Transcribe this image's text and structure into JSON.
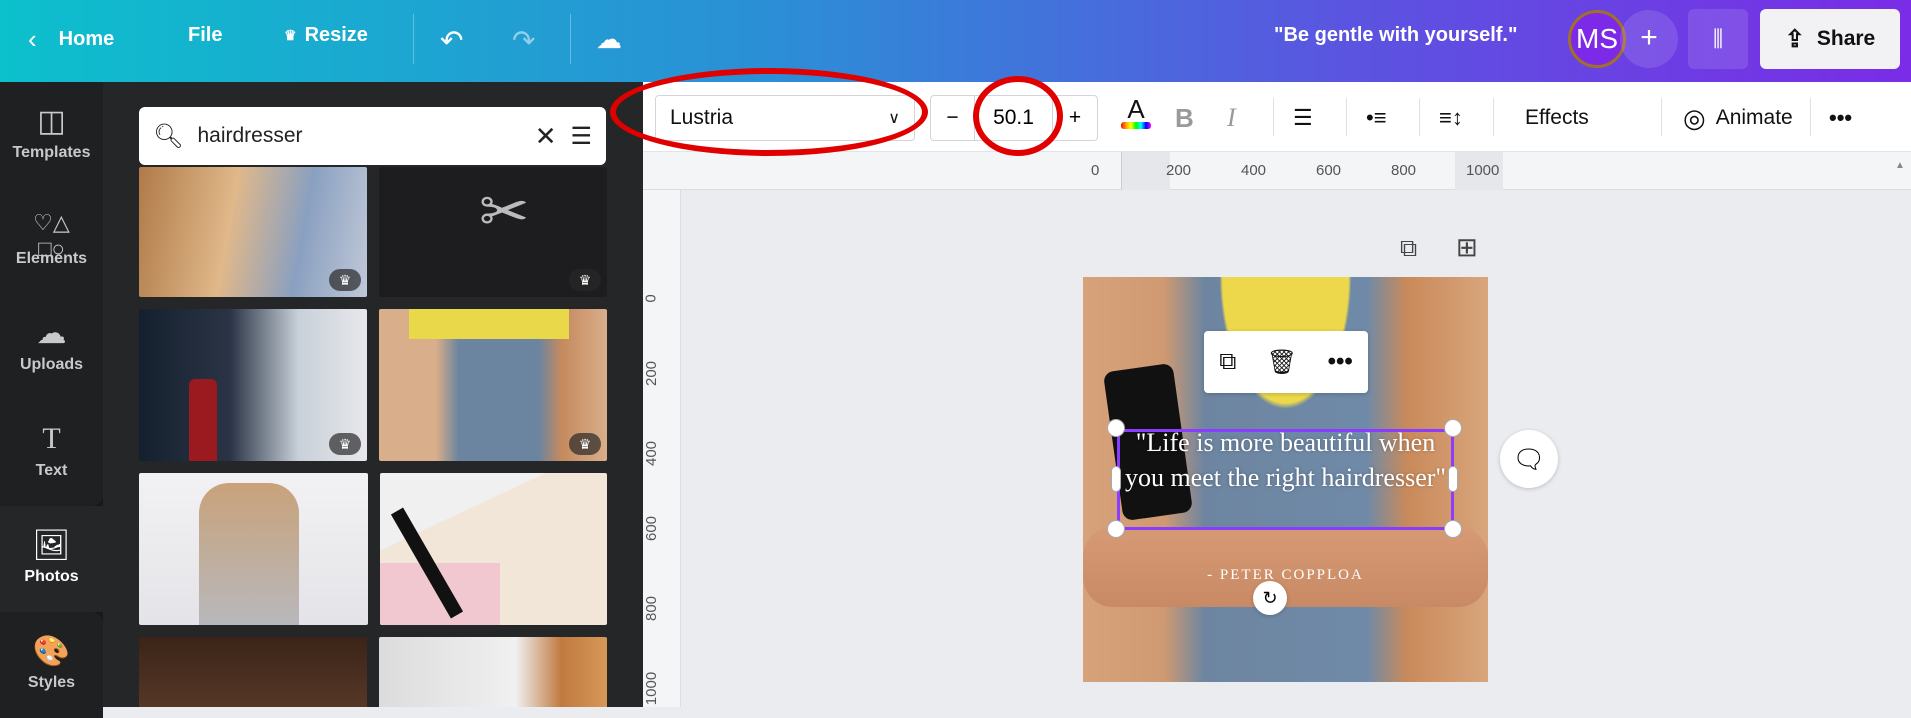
{
  "topbar": {
    "home": "Home",
    "file": "File",
    "resize": "Resize",
    "title": "\"Be gentle with yourself.\"",
    "avatar": "MS",
    "share": "Share"
  },
  "sidebar": {
    "items": [
      {
        "label": "Templates",
        "icon": "templates-icon"
      },
      {
        "label": "Elements",
        "icon": "elements-icon"
      },
      {
        "label": "Uploads",
        "icon": "upload-icon"
      },
      {
        "label": "Text",
        "icon": "text-icon"
      },
      {
        "label": "Photos",
        "icon": "photos-icon",
        "active": true
      },
      {
        "label": "Styles",
        "icon": "palette-icon"
      }
    ]
  },
  "search": {
    "value": "hairdresser"
  },
  "photos": [
    {
      "desc": "hair brushing",
      "premium": true
    },
    {
      "desc": "scissors on black",
      "premium": true
    },
    {
      "desc": "hair washing",
      "premium": true
    },
    {
      "desc": "hairdresser with apron",
      "premium": true
    },
    {
      "desc": "hair foil coloring",
      "premium": false
    },
    {
      "desc": "brush comb scissors",
      "premium": false
    },
    {
      "desc": "hanging scissors",
      "premium": false
    },
    {
      "desc": "wood and hair",
      "premium": false
    }
  ],
  "toolbar": {
    "font": "Lustria",
    "font_size": "50.1",
    "minus": "−",
    "plus": "+",
    "effects": "Effects",
    "animate": "Animate"
  },
  "ruler": {
    "h": [
      "0",
      "200",
      "400",
      "600",
      "800",
      "1000"
    ],
    "v": [
      "0",
      "200",
      "400",
      "600",
      "800",
      "1000"
    ]
  },
  "canvas": {
    "quote": "\"Life is more beautiful when you meet the right hairdresser\"",
    "author": "- PETER COPPLOA"
  },
  "colors": {
    "accent": "#8b3dff",
    "annotation": "#e00000"
  }
}
